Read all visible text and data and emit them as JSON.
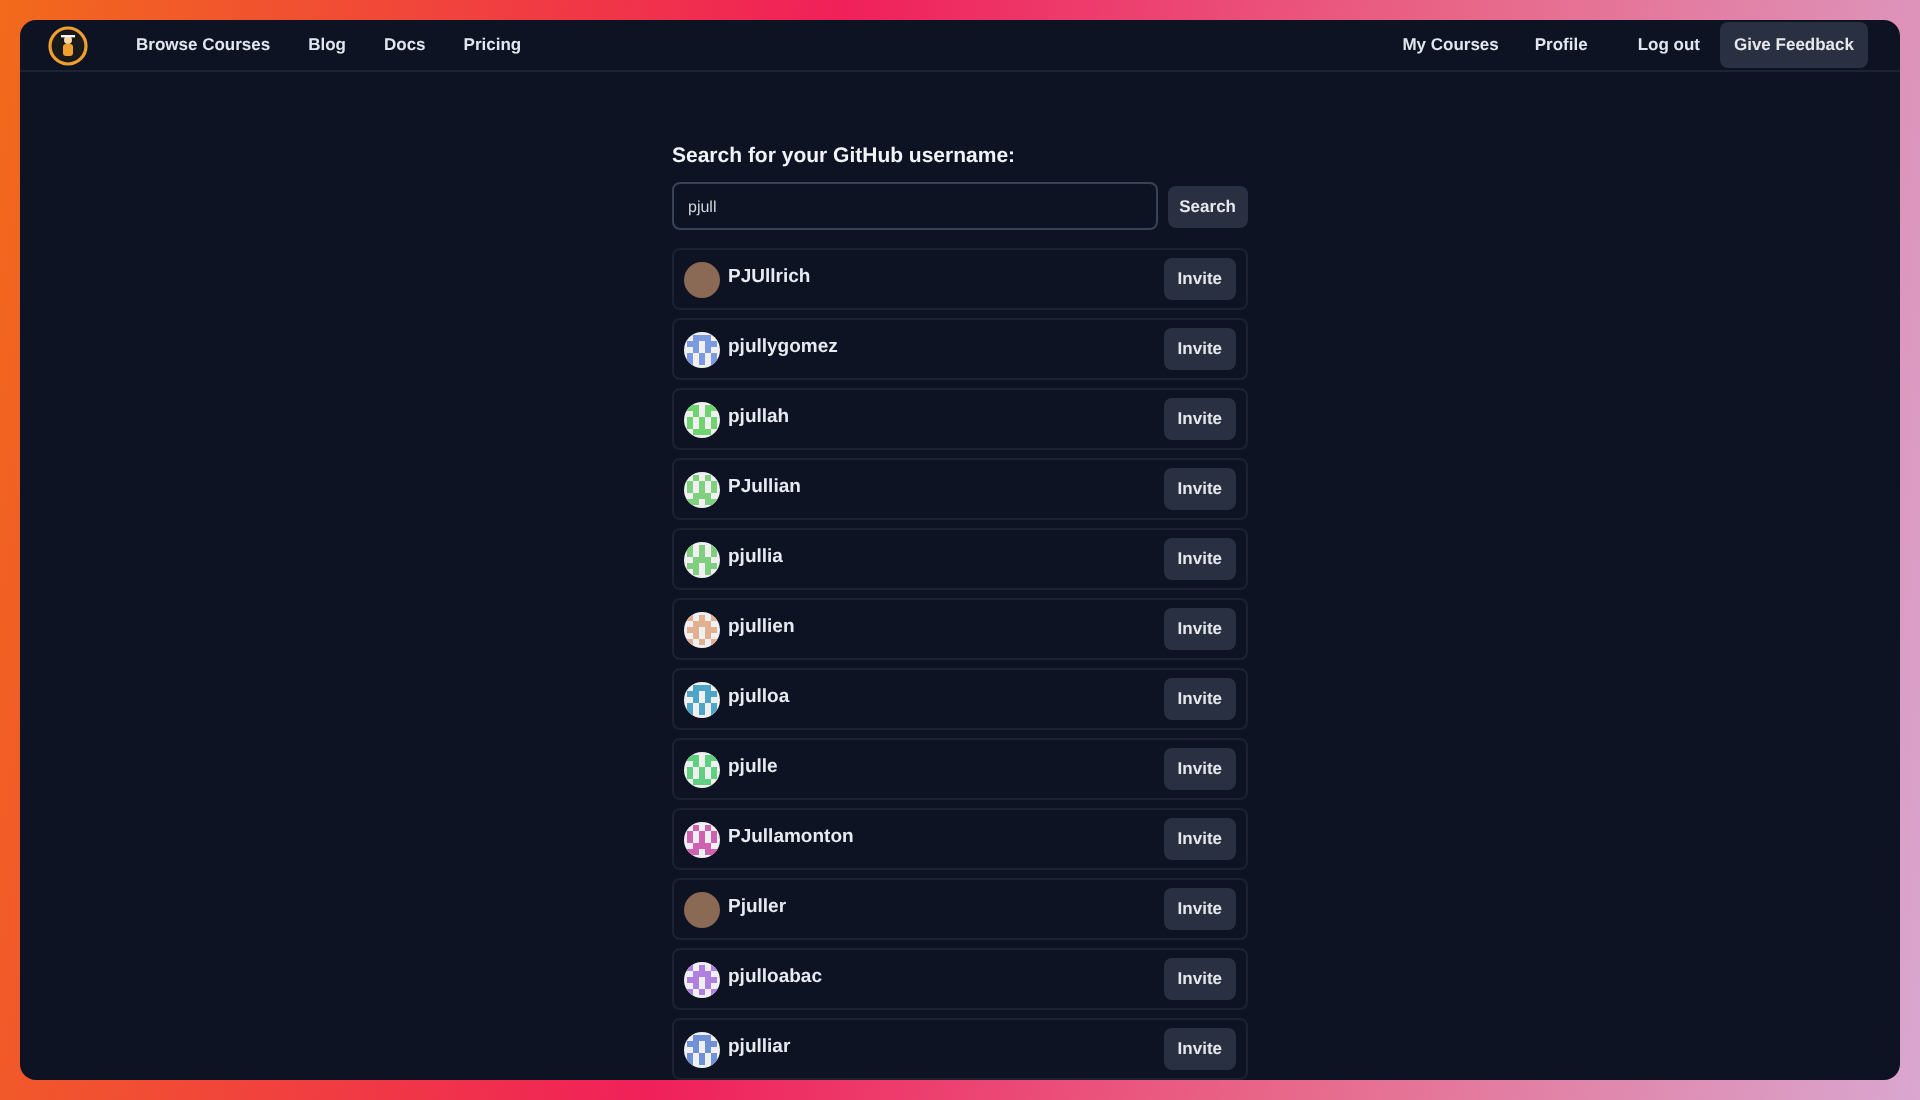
{
  "navbar": {
    "left_links": [
      "Browse Courses",
      "Blog",
      "Docs",
      "Pricing"
    ],
    "right_links": [
      "My Courses",
      "Profile",
      "Log out"
    ],
    "feedback_button": "Give Feedback"
  },
  "search": {
    "heading": "Search for your GitHub username:",
    "value": "pjull",
    "button": "Search"
  },
  "users": [
    {
      "name": "PJUllrich",
      "kind": "photo",
      "button": "Invite"
    },
    {
      "name": "pjullygomez",
      "kind": "identicon",
      "color": "#7b9ae0",
      "button": "Invite"
    },
    {
      "name": "pjullah",
      "kind": "identicon",
      "color": "#6fd36f",
      "button": "Invite"
    },
    {
      "name": "PJullian",
      "kind": "identicon",
      "color": "#7fd17f",
      "button": "Invite"
    },
    {
      "name": "pjullia",
      "kind": "identicon",
      "color": "#80cf80",
      "button": "Invite"
    },
    {
      "name": "pjullien",
      "kind": "identicon",
      "color": "#e0b090",
      "button": "Invite"
    },
    {
      "name": "pjulloa",
      "kind": "identicon",
      "color": "#4fa5c8",
      "button": "Invite"
    },
    {
      "name": "pjulle",
      "kind": "identicon",
      "color": "#5fd07f",
      "button": "Invite"
    },
    {
      "name": "PJullamonton",
      "kind": "identicon",
      "color": "#d060b0",
      "button": "Invite"
    },
    {
      "name": "Pjuller",
      "kind": "photo",
      "button": "Invite"
    },
    {
      "name": "pjulloabac",
      "kind": "identicon",
      "color": "#b080e0",
      "button": "Invite"
    },
    {
      "name": "pjulliar",
      "kind": "identicon",
      "color": "#7090d8",
      "button": "Invite"
    }
  ]
}
